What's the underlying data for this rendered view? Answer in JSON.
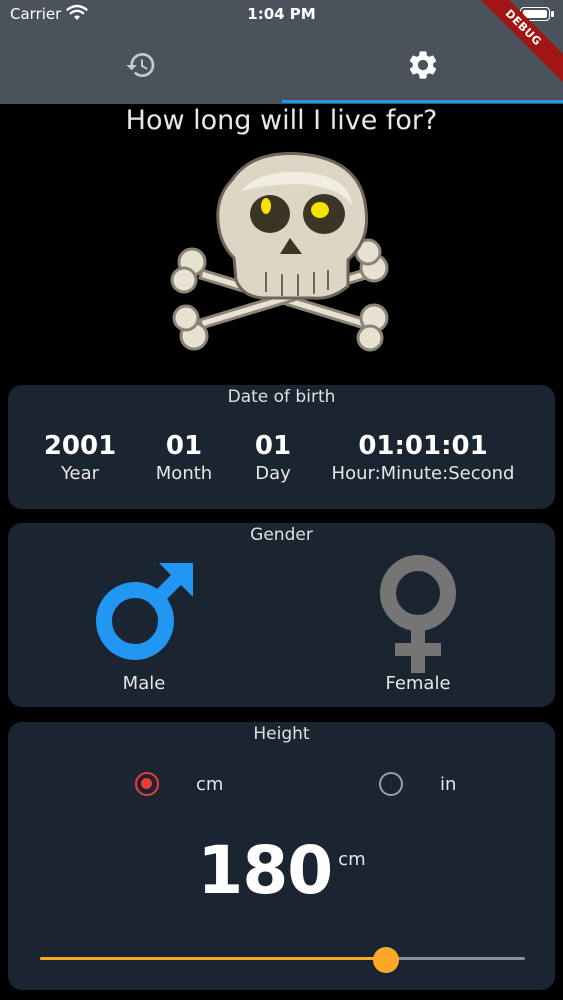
{
  "status_bar": {
    "carrier": "Carrier",
    "time": "1:04 PM"
  },
  "debug_banner": "DEBUG",
  "tabs": [
    {
      "icon": "history-icon",
      "selected": false
    },
    {
      "icon": "settings-icon",
      "selected": true
    }
  ],
  "title": "How long will I live for?",
  "date_of_birth": {
    "title": "Date of birth",
    "year": {
      "value": "2001",
      "label": "Year"
    },
    "month": {
      "value": "01",
      "label": "Month"
    },
    "day": {
      "value": "01",
      "label": "Day"
    },
    "time": {
      "value": "01:01:01",
      "label": "Hour:Minute:Second"
    }
  },
  "gender": {
    "title": "Gender",
    "male": {
      "label": "Male",
      "color": "#2196f3",
      "selected": true
    },
    "female": {
      "label": "Female",
      "color": "#757575",
      "selected": false
    }
  },
  "height": {
    "title": "Height",
    "units": [
      {
        "label": "cm",
        "selected": true
      },
      {
        "label": "in",
        "selected": false
      }
    ],
    "value": "180",
    "unit": "cm",
    "slider_fraction": 0.714,
    "slider_color": "#ffa726"
  }
}
